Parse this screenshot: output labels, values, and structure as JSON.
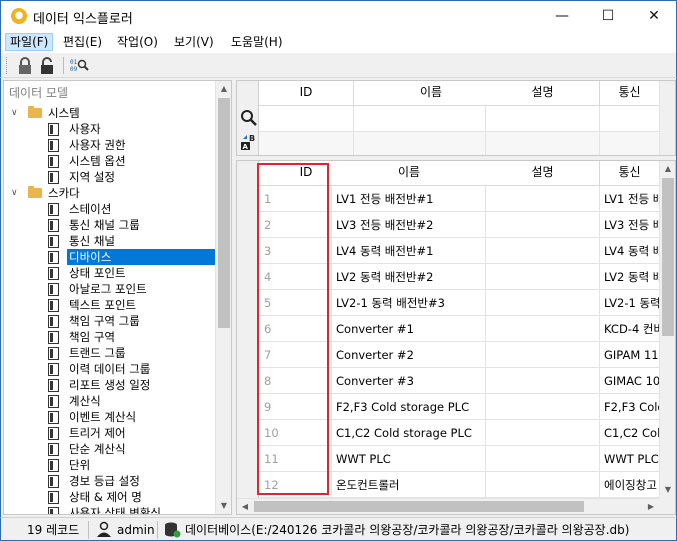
{
  "window": {
    "title": "데이터 익스플로러",
    "minimize_glyph": "—",
    "maximize_glyph": "☐",
    "close_glyph": "✕"
  },
  "menu": [
    "파일(F)",
    "편집(E)",
    "작업(O)",
    "보기(V)",
    "도움말(H)"
  ],
  "toolbar": {
    "icons": [
      "lock-icon",
      "unlock-icon",
      "binary-search-icon"
    ]
  },
  "tree": {
    "header": "데이터 모델",
    "groups": [
      {
        "label": "시스템",
        "items": [
          "사용자",
          "사용자 권한",
          "시스템 옵션",
          "지역 설정"
        ]
      },
      {
        "label": "스카다",
        "items": [
          "스테이션",
          "통신 채널 그룹",
          "통신 채널",
          "디바이스",
          "상태 포인트",
          "아날로그 포인트",
          "텍스트 포인트",
          "책임 구역 그룹",
          "책임 구역",
          "트랜드 그룹",
          "이력 데이터 그룹",
          "리포트 생성 일정",
          "계산식",
          "이벤트 계산식",
          "트리거 제어",
          "단순 계산식",
          "단위",
          "경보 등급 설정",
          "상태 & 제어 명",
          "사용자 상태 변환식"
        ]
      }
    ],
    "selected": "디바이스"
  },
  "filter": {
    "columns": [
      "ID",
      "이름",
      "설명",
      "통신"
    ],
    "search_icon": "search-icon",
    "sort_icon": "sort-ab-icon"
  },
  "grid": {
    "columns": [
      "ID",
      "이름",
      "설명",
      "통신"
    ],
    "rows": [
      {
        "id": "1",
        "name": "LV1 전등 배전반#1",
        "desc": "",
        "comm": "LV1 전등 배"
      },
      {
        "id": "2",
        "name": "LV3 전등 배전반#2",
        "desc": "",
        "comm": "LV3 전등 배"
      },
      {
        "id": "3",
        "name": "LV4 동력 배전반#1",
        "desc": "",
        "comm": "LV4 동력 배"
      },
      {
        "id": "4",
        "name": "LV2 동력 배전반#2",
        "desc": "",
        "comm": "LV2 동력 배"
      },
      {
        "id": "5",
        "name": "LV2-1 동력 배전반#3",
        "desc": "",
        "comm": "LV2-1 동력"
      },
      {
        "id": "6",
        "name": "Converter #1",
        "desc": "",
        "comm": "KCD-4 컨버"
      },
      {
        "id": "7",
        "name": "Converter #2",
        "desc": "",
        "comm": "GIPAM 11"
      },
      {
        "id": "8",
        "name": "Converter #3",
        "desc": "",
        "comm": "GIMAC 10"
      },
      {
        "id": "9",
        "name": "F2,F3 Cold storage PLC",
        "desc": "",
        "comm": "F2,F3 Cold"
      },
      {
        "id": "10",
        "name": "C1,C2 Cold storage PLC",
        "desc": "",
        "comm": "C1,C2 Cold"
      },
      {
        "id": "11",
        "name": "WWT PLC",
        "desc": "",
        "comm": "WWT PLC"
      },
      {
        "id": "12",
        "name": "온도컨트롤러",
        "desc": "",
        "comm": "에이징창고"
      }
    ]
  },
  "status": {
    "records": "19 레코드",
    "user": "admin",
    "database": "데이터베이스(E:/240126 코카콜라 의왕공장/코카콜라 의왕공장/코카콜라 의왕공장.db)"
  },
  "colors": {
    "accent": "#0078d7",
    "highlight_border": "#e1252f",
    "window_border": "#2b6cb3"
  }
}
